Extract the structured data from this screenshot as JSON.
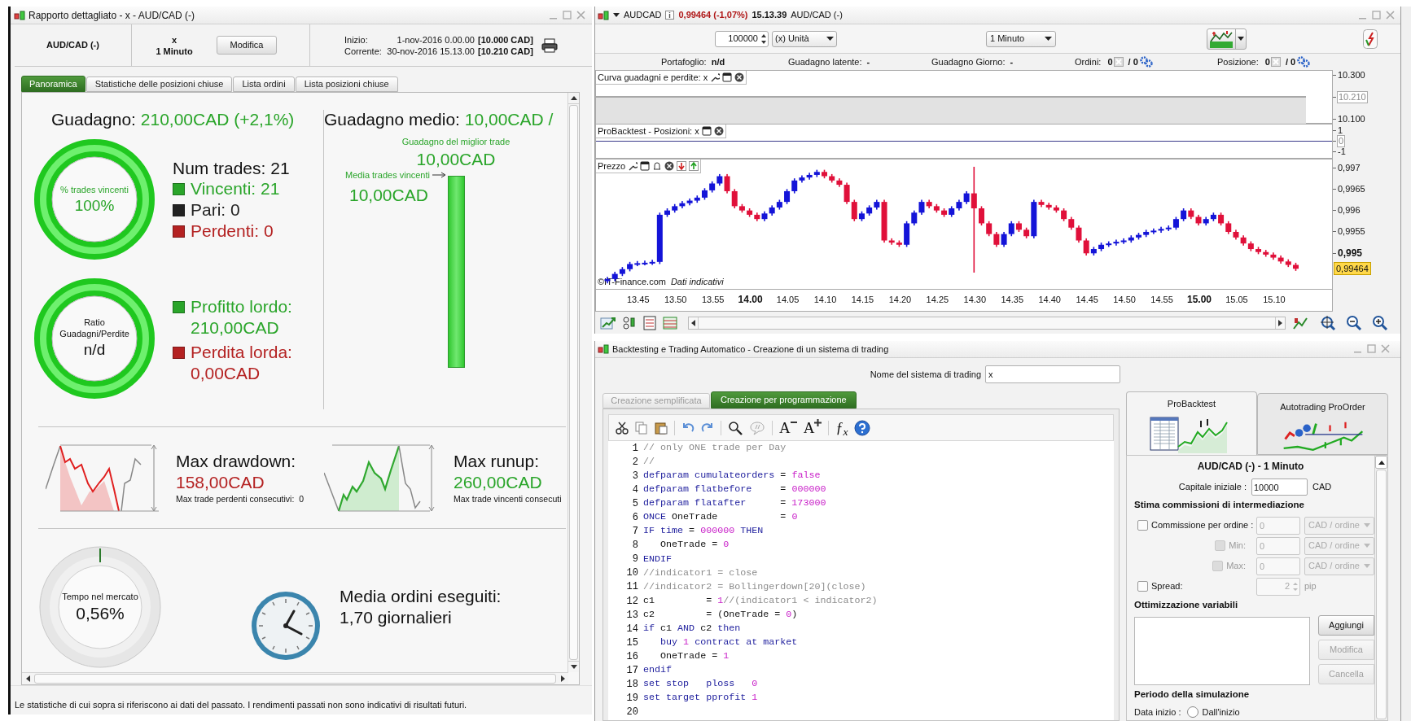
{
  "report_window": {
    "title": "Rapporto dettagliato - x - AUD/CAD (-)",
    "instrument": "AUD/CAD (-)",
    "system": "x",
    "timeframe": "1 Minuto",
    "modify_button": "Modifica",
    "period": [
      {
        "label": "Inizio:",
        "date": "1-nov-2016 0.00.00",
        "capital": "[10.000 CAD]"
      },
      {
        "label": "Corrente:",
        "date": "30-nov-2016 15.13.00",
        "capital": "[10.210 CAD]"
      }
    ],
    "tabs": [
      {
        "label": "Panoramica",
        "selected": true
      },
      {
        "label": "Statistiche delle posizioni chiuse",
        "selected": false
      },
      {
        "label": "Lista ordini",
        "selected": false
      },
      {
        "label": "Lista posizioni chiuse",
        "selected": false
      }
    ],
    "gain": {
      "label": "Guadagno:",
      "value": "210,00CAD (+2,1%)"
    },
    "win_gauge": {
      "label": "% trades vincenti",
      "value": "100%"
    },
    "num_trades": "Num trades: 21",
    "trade_counts": [
      {
        "text": "Vincenti: 21",
        "color": "#2aa52a"
      },
      {
        "text": "Pari: 0",
        "color": "#222222"
      },
      {
        "text": "Perdenti: 0",
        "color": "#b42222"
      }
    ],
    "ratio_gauge": {
      "label": "Ratio Guadagni/Perdite",
      "value": "n/d"
    },
    "gross": [
      {
        "label": "Profitto lordo:",
        "value": "210,00CAD",
        "color": "#2aa52a"
      },
      {
        "label": "Perdita lorda:",
        "value": "0,00CAD",
        "color": "#b42222"
      }
    ],
    "avg_gain": {
      "label": "Guadagno medio:",
      "value": "10,00CAD /"
    },
    "best_trade": {
      "label": "Guadagno del miglior trade",
      "value": "10,00CAD"
    },
    "avg_winning": {
      "label": "Media trades vincenti",
      "value": "10,00CAD"
    },
    "drawdown": {
      "title": "Max drawdown:",
      "value": "158,00CAD",
      "note": "Max trade perdenti consecutivi:  0"
    },
    "runup": {
      "title": "Max runup:",
      "value": "260,00CAD",
      "note": "Max trade vincenti consecuti"
    },
    "market_time": {
      "label": "Tempo nel mercato",
      "value": "0,56%"
    },
    "orders": {
      "label": "Media ordini eseguiti:",
      "value": "1,70 giornalieri"
    },
    "disclaimer": "Le statistiche di cui sopra si riferiscono ai dati del passato. I rendimenti passati non sono indicativi di risultati futuri."
  },
  "chart_window": {
    "symbol": "AUDCAD",
    "price": "0,99464 (-1,07%)",
    "time": "15.13.39",
    "instrument": "AUD/CAD (-)",
    "quantity": "100000",
    "unit": "(x) Unità",
    "timeframe": "1 Minuto",
    "stats": [
      {
        "label": "Portafoglio:",
        "value": "n/d"
      },
      {
        "label": "Guadagno latente:",
        "value": "-"
      },
      {
        "label": "Guadagno Giorno:",
        "value": "-"
      }
    ],
    "counters": [
      {
        "label": "Ordini:",
        "first": "0",
        "second": "/ 0"
      },
      {
        "label": "Posizione:",
        "first": "0",
        "second": "/ 0"
      }
    ],
    "equity_panel": {
      "title": "Curva guadagni e perdite: x",
      "ticks": [
        {
          "label": "10.300",
          "boxed": false
        },
        {
          "label": "10.210",
          "boxed": true
        },
        {
          "label": "10.100",
          "boxed": false
        }
      ]
    },
    "positions_panel": {
      "title": "ProBacktest - Posizioni: x",
      "ticks": [
        {
          "label": "1",
          "boxed": false
        },
        {
          "label": "0",
          "boxed": true
        },
        {
          "label": "-1",
          "boxed": false
        }
      ]
    },
    "price_panel": {
      "title": "Prezzo",
      "last_price": "0,99464",
      "source": "©IT-Finance.com",
      "source_note": "Dati indicativi",
      "time_label_bold": [
        false,
        false,
        false,
        true,
        false,
        false,
        false,
        false,
        false,
        false,
        false,
        false,
        false,
        false,
        false,
        true,
        false,
        false
      ],
      "price_label_bold": [
        false,
        false,
        false,
        false,
        true
      ],
      "chart_data": {
        "type": "candlestick",
        "categories": [
          null,
          null,
          null,
          null,
          "13.45",
          null,
          null,
          null,
          null,
          "13.50",
          null,
          null,
          null,
          null,
          "13.55",
          null,
          null,
          null,
          null,
          "14.00",
          null,
          null,
          null,
          null,
          "14.05",
          null,
          null,
          null,
          null,
          "14.10",
          null,
          null,
          null,
          null,
          "14.15",
          null,
          null,
          null,
          null,
          "14.20",
          null,
          null,
          null,
          null,
          "14.25",
          null,
          null,
          null,
          null,
          "14.30",
          null,
          null,
          null,
          null,
          "14.35",
          null,
          null,
          null,
          null,
          "14.40",
          null,
          null,
          null,
          null,
          "14.45",
          null,
          null,
          null,
          null,
          "14.50",
          null,
          null,
          null,
          null,
          "14.55",
          null,
          null,
          null,
          null,
          "15.00",
          null,
          null,
          null,
          null,
          "15.05",
          null,
          null,
          null,
          null,
          "15.10",
          null,
          null,
          null
        ],
        "ylim": [
          0.99417,
          0.99719
        ],
        "yticks": [
          {
            "value": 0.997,
            "label": "0,997"
          },
          {
            "value": 0.9965,
            "label": "0,9965"
          },
          {
            "value": 0.996,
            "label": "0,996"
          },
          {
            "value": 0.9955,
            "label": "0,9955"
          },
          {
            "value": 0.995,
            "label": "0,995"
          }
        ],
        "ohlc": [
          [
            0.99435,
            0.99445,
            0.9943,
            0.9944
          ],
          [
            0.9944,
            0.99457,
            0.99435,
            0.99452
          ],
          [
            0.99452,
            0.99468,
            0.99447,
            0.99463
          ],
          [
            0.99463,
            0.9948,
            0.99458,
            0.99475
          ],
          [
            0.99475,
            0.99482,
            0.9947,
            0.99477
          ],
          [
            0.99477,
            0.99483,
            0.99472,
            0.99478
          ],
          [
            0.99478,
            0.99485,
            0.99473,
            0.9948
          ],
          [
            0.9948,
            0.99595,
            0.99475,
            0.9959
          ],
          [
            0.9959,
            0.99605,
            0.99585,
            0.996
          ],
          [
            0.996,
            0.99615,
            0.99595,
            0.9961
          ],
          [
            0.9961,
            0.99622,
            0.99605,
            0.99617
          ],
          [
            0.99617,
            0.99628,
            0.99612,
            0.99623
          ],
          [
            0.99623,
            0.99635,
            0.99618,
            0.9963
          ],
          [
            0.9963,
            0.99652,
            0.99625,
            0.99647
          ],
          [
            0.99647,
            0.99668,
            0.99642,
            0.99663
          ],
          [
            0.99663,
            0.99685,
            0.99658,
            0.9968
          ],
          [
            0.9968,
            0.99685,
            0.9964,
            0.99645
          ],
          [
            0.99645,
            0.9965,
            0.99605,
            0.9961
          ],
          [
            0.9961,
            0.99615,
            0.99595,
            0.996
          ],
          [
            0.996,
            0.99605,
            0.99585,
            0.9959
          ],
          [
            0.9959,
            0.99595,
            0.99575,
            0.9958
          ],
          [
            0.9958,
            0.99598,
            0.99575,
            0.99593
          ],
          [
            0.99593,
            0.99612,
            0.99588,
            0.99607
          ],
          [
            0.99607,
            0.99625,
            0.99602,
            0.9962
          ],
          [
            0.9962,
            0.9965,
            0.99615,
            0.99645
          ],
          [
            0.99645,
            0.99675,
            0.9964,
            0.9967
          ],
          [
            0.9967,
            0.99682,
            0.99665,
            0.99677
          ],
          [
            0.99677,
            0.99688,
            0.99672,
            0.99683
          ],
          [
            0.99683,
            0.99695,
            0.99678,
            0.9969
          ],
          [
            0.9969,
            0.99695,
            0.99675,
            0.9968
          ],
          [
            0.9968,
            0.99685,
            0.99665,
            0.9967
          ],
          [
            0.9967,
            0.99675,
            0.99655,
            0.9966
          ],
          [
            0.9966,
            0.99665,
            0.99615,
            0.9962
          ],
          [
            0.9962,
            0.99625,
            0.99575,
            0.9958
          ],
          [
            0.9958,
            0.99598,
            0.99575,
            0.99593
          ],
          [
            0.99593,
            0.99612,
            0.99588,
            0.99607
          ],
          [
            0.99607,
            0.99625,
            0.99602,
            0.9962
          ],
          [
            0.9962,
            0.99625,
            0.99525,
            0.9953
          ],
          [
            0.9953,
            0.99535,
            0.9952,
            0.99525
          ],
          [
            0.99525,
            0.9953,
            0.99515,
            0.9952
          ],
          [
            0.9952,
            0.99575,
            0.99515,
            0.9957
          ],
          [
            0.9957,
            0.996,
            0.99565,
            0.99595
          ],
          [
            0.99595,
            0.99625,
            0.9959,
            0.9962
          ],
          [
            0.9962,
            0.99625,
            0.99605,
            0.9961
          ],
          [
            0.9961,
            0.99615,
            0.99595,
            0.996
          ],
          [
            0.996,
            0.99605,
            0.99585,
            0.9959
          ],
          [
            0.9959,
            0.9961,
            0.99585,
            0.99605
          ],
          [
            0.99605,
            0.99625,
            0.996,
            0.9962
          ],
          [
            0.9962,
            0.99645,
            0.99615,
            0.9964
          ],
          [
            0.9964,
            0.99702,
            0.99455,
            0.99605
          ],
          [
            0.99605,
            0.9961,
            0.99565,
            0.9957
          ],
          [
            0.9957,
            0.99575,
            0.9954,
            0.99545
          ],
          [
            0.99545,
            0.9955,
            0.99515,
            0.9952
          ],
          [
            0.9952,
            0.9955,
            0.99515,
            0.99545
          ],
          [
            0.99545,
            0.99575,
            0.9954,
            0.9957
          ],
          [
            0.9957,
            0.99575,
            0.9955,
            0.99555
          ],
          [
            0.99555,
            0.9956,
            0.99535,
            0.9954
          ],
          [
            0.9954,
            0.99625,
            0.99535,
            0.9962
          ],
          [
            0.9962,
            0.99625,
            0.99608,
            0.99613
          ],
          [
            0.99613,
            0.99618,
            0.99602,
            0.99607
          ],
          [
            0.99607,
            0.99612,
            0.99595,
            0.996
          ],
          [
            0.996,
            0.99605,
            0.99575,
            0.9958
          ],
          [
            0.9958,
            0.99585,
            0.99555,
            0.9956
          ],
          [
            0.9956,
            0.99565,
            0.99525,
            0.9953
          ],
          [
            0.9953,
            0.99535,
            0.99495,
            0.995
          ],
          [
            0.995,
            0.99515,
            0.99495,
            0.9951
          ],
          [
            0.9951,
            0.99525,
            0.99505,
            0.9952
          ],
          [
            0.9952,
            0.99528,
            0.99515,
            0.99523
          ],
          [
            0.99523,
            0.99532,
            0.99518,
            0.99527
          ],
          [
            0.99527,
            0.99535,
            0.99522,
            0.9953
          ],
          [
            0.9953,
            0.99542,
            0.99525,
            0.99537
          ],
          [
            0.99537,
            0.99548,
            0.99532,
            0.99543
          ],
          [
            0.99543,
            0.99555,
            0.99538,
            0.9955
          ],
          [
            0.9955,
            0.99558,
            0.99545,
            0.99553
          ],
          [
            0.99553,
            0.99562,
            0.99548,
            0.99557
          ],
          [
            0.99557,
            0.99565,
            0.99552,
            0.9956
          ],
          [
            0.9956,
            0.99585,
            0.99555,
            0.9958
          ],
          [
            0.9958,
            0.99605,
            0.99575,
            0.996
          ],
          [
            0.996,
            0.99605,
            0.9958,
            0.99585
          ],
          [
            0.99585,
            0.9959,
            0.99565,
            0.9957
          ],
          [
            0.9957,
            0.99585,
            0.99565,
            0.9958
          ],
          [
            0.9958,
            0.99595,
            0.99575,
            0.9959
          ],
          [
            0.9959,
            0.99595,
            0.99565,
            0.9957
          ],
          [
            0.9957,
            0.99575,
            0.99545,
            0.9955
          ],
          [
            0.9955,
            0.99555,
            0.99532,
            0.99537
          ],
          [
            0.99537,
            0.99542,
            0.99518,
            0.99523
          ],
          [
            0.99523,
            0.99528,
            0.99505,
            0.9951
          ],
          [
            0.9951,
            0.99515,
            0.99498,
            0.99503
          ],
          [
            0.99503,
            0.99508,
            0.99492,
            0.99497
          ],
          [
            0.99497,
            0.99502,
            0.99485,
            0.9949
          ],
          [
            0.9949,
            0.99495,
            0.99476,
            0.99481
          ],
          [
            0.99481,
            0.99486,
            0.99468,
            0.99473
          ],
          [
            0.99473,
            0.99478,
            0.99459,
            0.99464
          ]
        ]
      }
    }
  },
  "backtest_window": {
    "title": "Backtesting e Trading Automatico - Creazione di un sistema di trading",
    "name_label": "Nome del sistema di trading",
    "name_value": "x",
    "tabs": [
      {
        "label": "Creazione semplificata",
        "selected": false
      },
      {
        "label": "Creazione per programmazione",
        "selected": true
      }
    ],
    "toolbar": {
      "font_smaller": "A",
      "font_larger": "A",
      "function": "ƒ$_{x}$"
    },
    "code": [
      {
        "number": "1",
        "tokens": [
          {
            "kind": "comment",
            "text": "// only ONE trade per Day"
          }
        ]
      },
      {
        "number": "2",
        "tokens": [
          {
            "kind": "comment",
            "text": "//"
          }
        ]
      },
      {
        "number": "3",
        "tokens": [
          {
            "kind": "keyword",
            "text": "defparam cumulateorders"
          },
          {
            "kind": "plain",
            "text": " = "
          },
          {
            "kind": "number",
            "text": "false"
          }
        ]
      },
      {
        "number": "4",
        "tokens": [
          {
            "kind": "keyword",
            "text": "defparam flatbefore"
          },
          {
            "kind": "plain",
            "text": "     = "
          },
          {
            "kind": "number",
            "text": "000000"
          }
        ]
      },
      {
        "number": "5",
        "tokens": [
          {
            "kind": "keyword",
            "text": "defparam flatafter"
          },
          {
            "kind": "plain",
            "text": "      = "
          },
          {
            "kind": "number",
            "text": "173000"
          }
        ]
      },
      {
        "number": "6",
        "tokens": [
          {
            "kind": "keyword",
            "text": "ONCE"
          },
          {
            "kind": "plain",
            "text": " OneTrade           = "
          },
          {
            "kind": "number",
            "text": "0"
          }
        ]
      },
      {
        "number": "7",
        "tokens": [
          {
            "kind": "keyword",
            "text": "IF time"
          },
          {
            "kind": "plain",
            "text": " = "
          },
          {
            "kind": "number",
            "text": "000000"
          },
          {
            "kind": "keyword",
            "text": " THEN"
          }
        ]
      },
      {
        "number": "8",
        "tokens": [
          {
            "kind": "plain",
            "text": "   OneTrade = "
          },
          {
            "kind": "number",
            "text": "0"
          }
        ]
      },
      {
        "number": "9",
        "tokens": [
          {
            "kind": "keyword",
            "text": "ENDIF"
          }
        ]
      },
      {
        "number": "10",
        "tokens": [
          {
            "kind": "comment",
            "text": "//indicator1 = close"
          }
        ]
      },
      {
        "number": "11",
        "tokens": [
          {
            "kind": "comment",
            "text": "//indicator2 = Bollingerdown[20](close)"
          }
        ]
      },
      {
        "number": "12",
        "tokens": [
          {
            "kind": "plain",
            "text": "c1         = "
          },
          {
            "kind": "number",
            "text": "1"
          },
          {
            "kind": "comment",
            "text": "//(indicator1 < indicator2)"
          }
        ]
      },
      {
        "number": "13",
        "tokens": [
          {
            "kind": "plain",
            "text": "c2         = (OneTrade = "
          },
          {
            "kind": "number",
            "text": "0"
          },
          {
            "kind": "plain",
            "text": ")"
          }
        ]
      },
      {
        "number": "14",
        "tokens": [
          {
            "kind": "keyword",
            "text": "if"
          },
          {
            "kind": "plain",
            "text": " c1 "
          },
          {
            "kind": "keyword",
            "text": "AND"
          },
          {
            "kind": "plain",
            "text": " c2 "
          },
          {
            "kind": "keyword",
            "text": "then"
          }
        ]
      },
      {
        "number": "15",
        "tokens": [
          {
            "kind": "keyword",
            "text": "   buy "
          },
          {
            "kind": "number",
            "text": "1"
          },
          {
            "kind": "keyword",
            "text": " contract at market"
          }
        ]
      },
      {
        "number": "16",
        "tokens": [
          {
            "kind": "plain",
            "text": "   OneTrade = "
          },
          {
            "kind": "number",
            "text": "1"
          }
        ]
      },
      {
        "number": "17",
        "tokens": [
          {
            "kind": "keyword",
            "text": "endif"
          }
        ]
      },
      {
        "number": "18",
        "tokens": [
          {
            "kind": "keyword",
            "text": "set stop   ploss"
          },
          {
            "kind": "number",
            "text": "   0"
          }
        ]
      },
      {
        "number": "19",
        "tokens": [
          {
            "kind": "keyword",
            "text": "set target pprofit"
          },
          {
            "kind": "number",
            "text": " 1"
          }
        ]
      },
      {
        "number": "20"
      }
    ],
    "side_tabs": [
      {
        "label": "ProBacktest",
        "selected": true
      },
      {
        "label": "Autotrading ProOrder",
        "selected": false
      }
    ],
    "heading": "AUD/CAD (-) - 1 Minuto",
    "capital": {
      "label": "Capitale iniziale :",
      "value": "10000",
      "unit": "CAD"
    },
    "commission_title": "Stima commissioni di intermediazione",
    "commission_rows": [
      {
        "kind": "option",
        "label": "Commissione per ordine :",
        "checked": false,
        "disabled": false,
        "value": "0",
        "unit": "CAD / ordine"
      },
      {
        "kind": "limit",
        "label": "Min:",
        "checked": false,
        "disabled": true,
        "value": "0",
        "unit": "CAD / ordine"
      },
      {
        "kind": "limit",
        "label": "Max:",
        "checked": false,
        "disabled": true,
        "value": "0",
        "unit": "CAD / ordine"
      }
    ],
    "spread": {
      "label": "Spread:",
      "checked": false,
      "value": "2",
      "unit": "pip"
    },
    "optimization_title": "Ottimizzazione variabili",
    "optimization_buttons": [
      {
        "label": "Aggiungi",
        "disabled": false
      },
      {
        "label": "Modifica",
        "disabled": true
      },
      {
        "label": "Cancella",
        "disabled": true
      }
    ],
    "period_title": "Periodo della simulazione",
    "start": {
      "label": "Data inizio :",
      "option": "Dall'inizio",
      "selected": false
    }
  }
}
